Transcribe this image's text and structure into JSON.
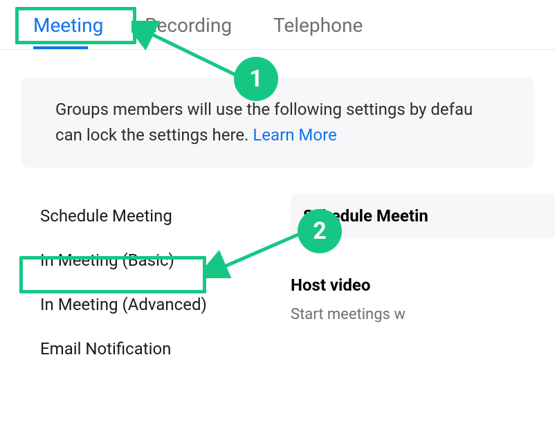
{
  "tabs": {
    "meeting": "Meeting",
    "recording": "Recording",
    "telephone": "Telephone"
  },
  "notice": {
    "text_a": "Groups members will use the following settings by defau",
    "text_b": "can lock the settings here.",
    "learn_more": "Learn More"
  },
  "subnav": {
    "schedule": "Schedule Meeting",
    "basic": "In Meeting (Basic)",
    "advanced": "In Meeting (Advanced)",
    "email": "Email Notification"
  },
  "main": {
    "schedule_heading": "Schedule Meetin",
    "host_video_title": "Host video",
    "host_video_desc": "Start meetings w"
  },
  "annotations": {
    "step1": "1",
    "step2": "2"
  }
}
